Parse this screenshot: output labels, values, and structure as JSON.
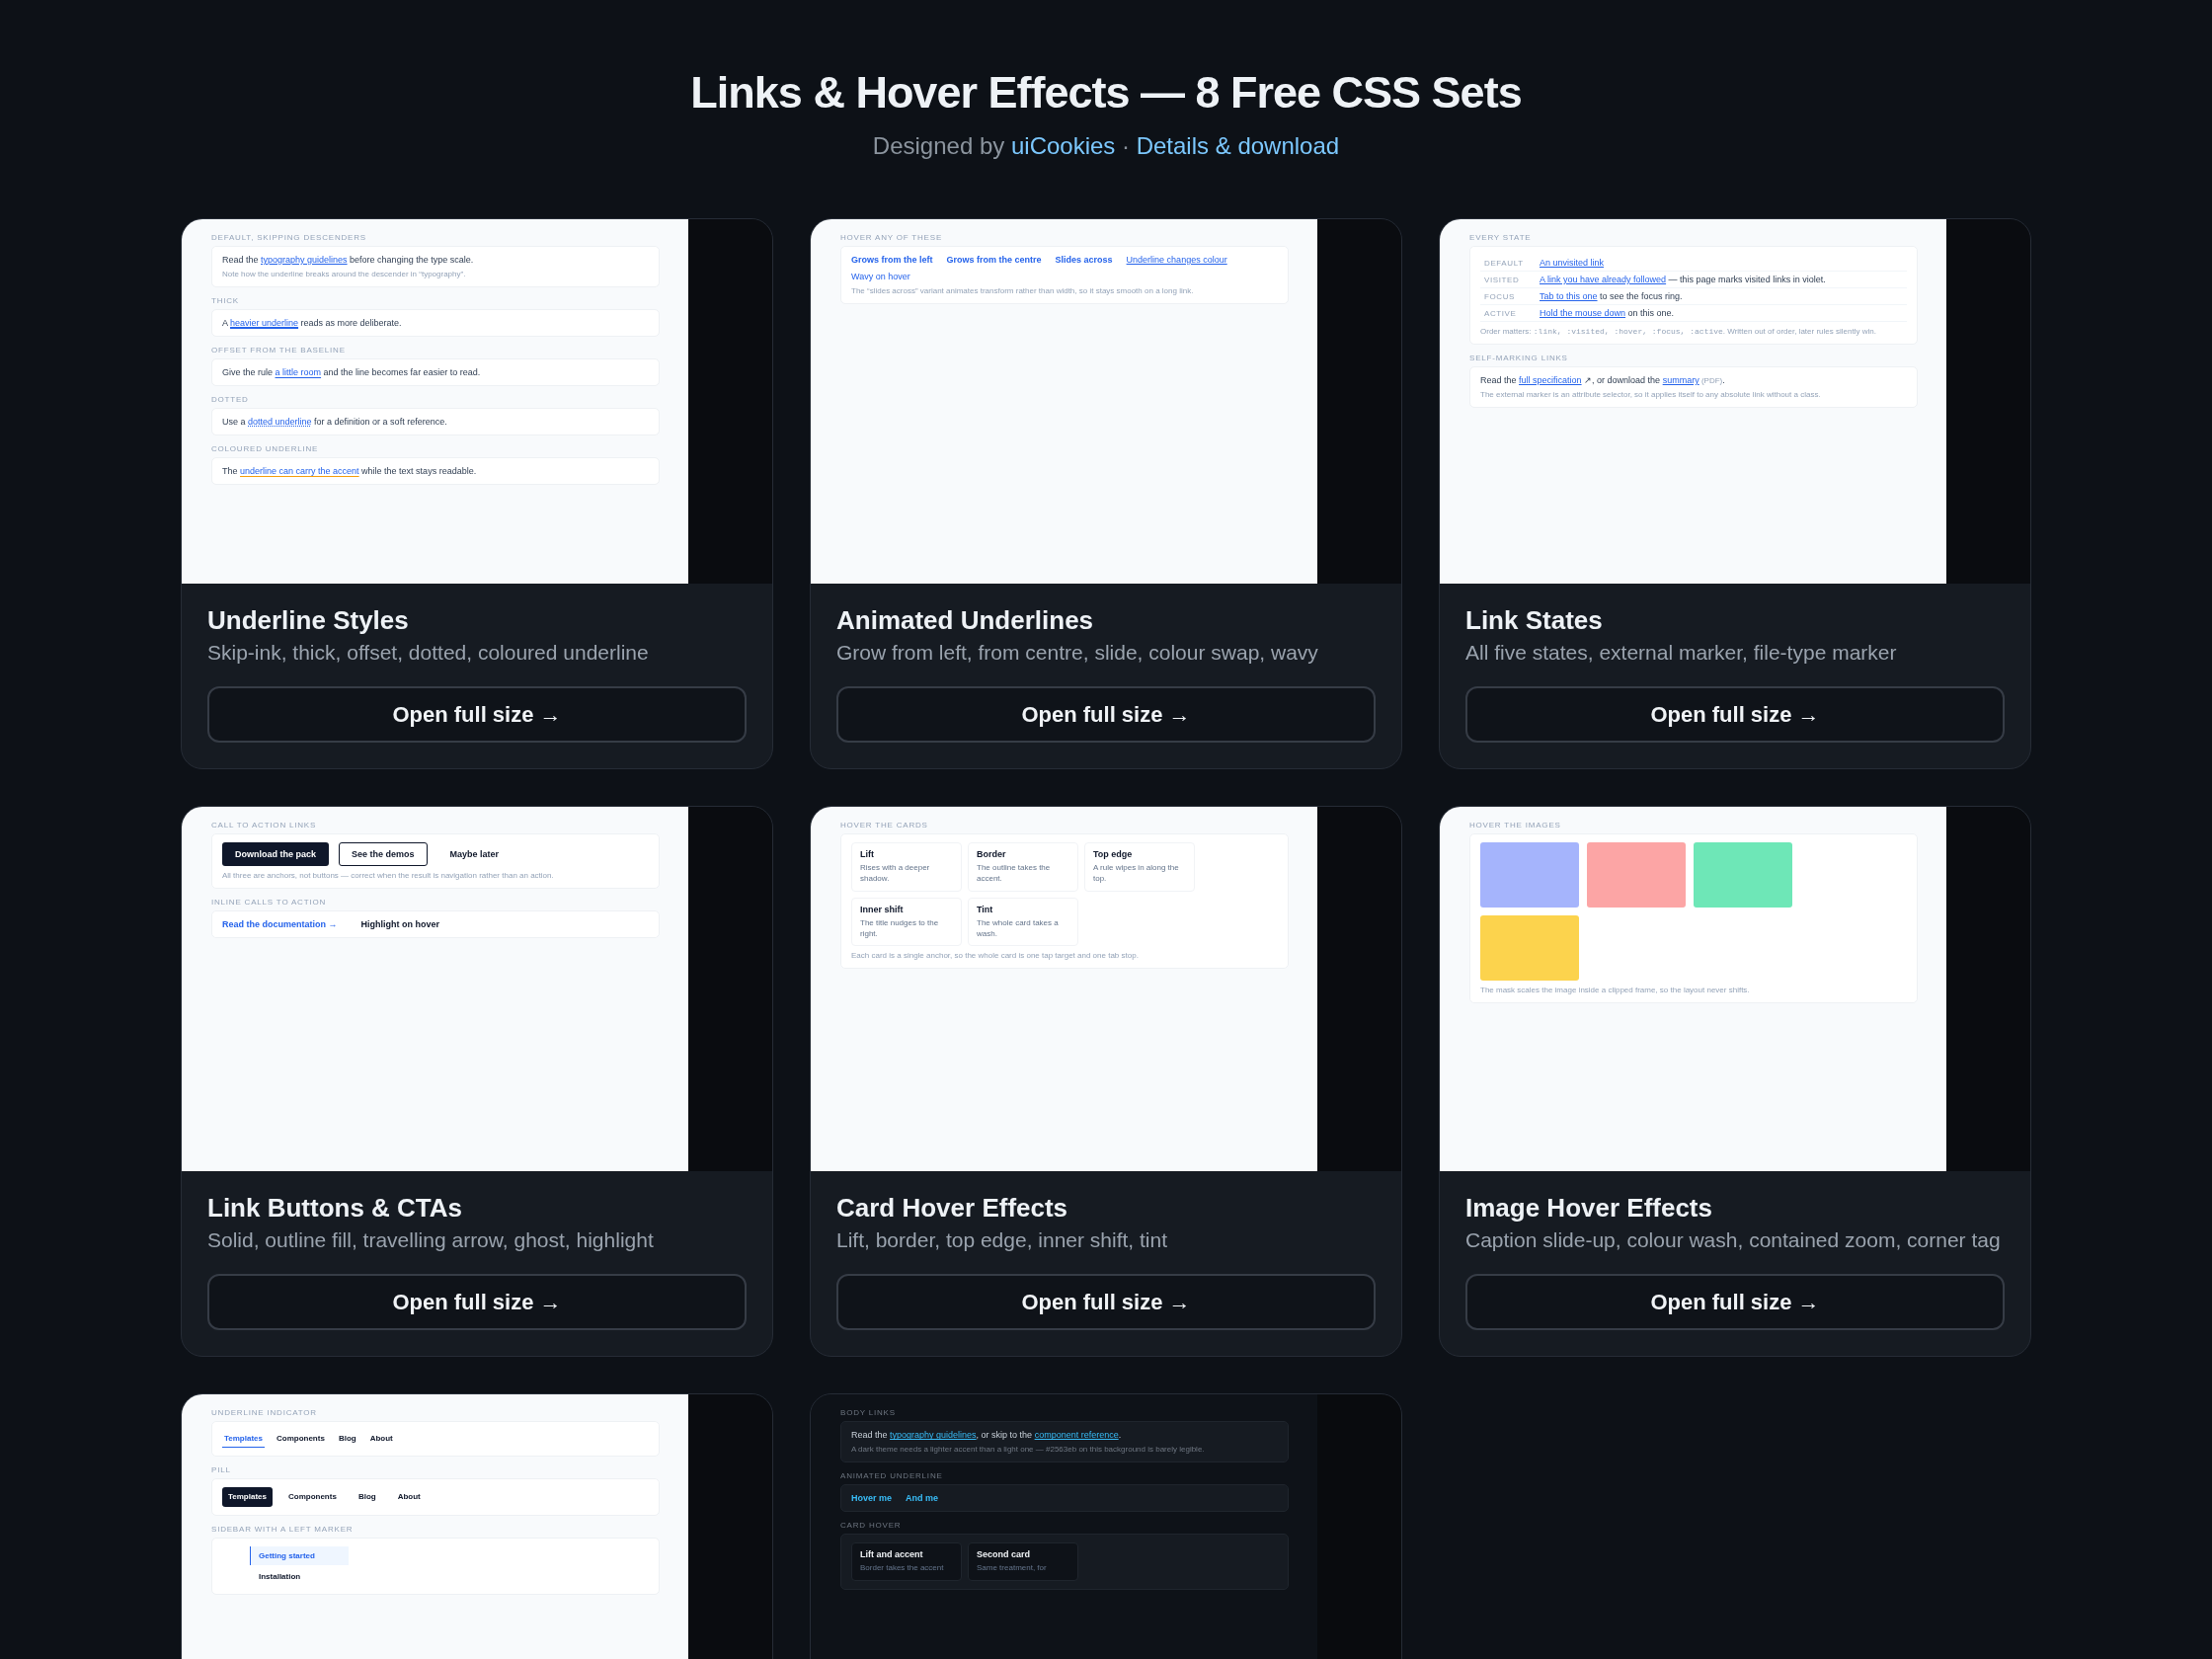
{
  "header": {
    "title": "Links & Hover Effects — 8 Free CSS Sets",
    "byline": [
      {
        "kind": "text",
        "text": "Designed by "
      },
      {
        "kind": "link",
        "text": "uiCookies"
      },
      {
        "kind": "text",
        "text": " · "
      },
      {
        "kind": "link",
        "text": "Details & download"
      }
    ]
  },
  "cards": [
    {
      "title": "Underline Styles",
      "subtitle": "Skip-ink, thick, offset, dotted, coloured underline",
      "button": "Open full size →",
      "preview": {
        "kind": "light",
        "sections": [
          {
            "label": "DEFAULT, SKIPPING DESCENDERS",
            "blocks": [
              {
                "kind": "para",
                "parts": [
                  {
                    "kind": "text",
                    "text": "Read the "
                  },
                  {
                    "kind": "link",
                    "text": "typography guidelines"
                  },
                  {
                    "kind": "text",
                    "text": " before changing the type scale."
                  }
                ]
              },
              {
                "kind": "note",
                "parts": [
                  {
                    "kind": "text",
                    "text": "Note how the underline breaks around the descender in “typography”."
                  }
                ]
              }
            ]
          },
          {
            "label": "THICK",
            "blocks": [
              {
                "kind": "para",
                "parts": [
                  {
                    "kind": "text",
                    "text": "A "
                  },
                  {
                    "kind": "link-thick",
                    "text": "heavier underline"
                  },
                  {
                    "kind": "text",
                    "text": " reads as more deliberate."
                  }
                ]
              }
            ]
          },
          {
            "label": "OFFSET FROM THE BASELINE",
            "blocks": [
              {
                "kind": "para",
                "parts": [
                  {
                    "kind": "text",
                    "text": "Give the rule "
                  },
                  {
                    "kind": "link-offset",
                    "text": "a little room"
                  },
                  {
                    "kind": "text",
                    "text": " and the line becomes far easier to read."
                  }
                ]
              }
            ]
          },
          {
            "label": "DOTTED",
            "blocks": [
              {
                "kind": "para",
                "parts": [
                  {
                    "kind": "text",
                    "text": "Use a "
                  },
                  {
                    "kind": "link-dotted",
                    "text": "dotted underline"
                  },
                  {
                    "kind": "text",
                    "text": " for a definition or a soft reference."
                  }
                ]
              }
            ]
          },
          {
            "label": "COLOURED UNDERLINE",
            "blocks": [
              {
                "kind": "para",
                "parts": [
                  {
                    "kind": "text",
                    "text": "The "
                  },
                  {
                    "kind": "link-accent",
                    "text": "underline can carry the accent"
                  },
                  {
                    "kind": "text",
                    "text": " while the text stays readable."
                  }
                ]
              }
            ]
          }
        ]
      }
    },
    {
      "title": "Animated Underlines",
      "subtitle": "Grow from left, from centre, slide, colour swap, wavy",
      "button": "Open full size →",
      "preview": {
        "kind": "light",
        "sections": [
          {
            "label": "HOVER ANY OF THESE",
            "blocks": [
              {
                "kind": "links",
                "items": [
                  {
                    "kind": "bold",
                    "text": "Grows from the left"
                  },
                  {
                    "kind": "bold",
                    "text": "Grows from the centre"
                  },
                  {
                    "kind": "bold",
                    "text": "Slides across"
                  },
                  {
                    "kind": "underlined",
                    "text": "Underline changes colour"
                  },
                  {
                    "kind": "regular",
                    "text": "Wavy on hover"
                  }
                ]
              },
              {
                "kind": "note",
                "parts": [
                  {
                    "kind": "text",
                    "text": "The “slides across” variant animates transform rather than width, so it stays smooth on a long link."
                  }
                ]
              }
            ]
          }
        ]
      }
    },
    {
      "title": "Link States",
      "subtitle": "All five states, external marker, file-type marker",
      "button": "Open full size →",
      "preview": {
        "kind": "light",
        "sections": [
          {
            "label": "EVERY STATE",
            "blocks": [
              {
                "kind": "states",
                "rows": [
                  {
                    "state": "DEFAULT",
                    "parts": [
                      {
                        "kind": "link",
                        "text": "An unvisited link"
                      }
                    ]
                  },
                  {
                    "state": "VISITED",
                    "parts": [
                      {
                        "kind": "link",
                        "text": "A link you have already followed"
                      },
                      {
                        "kind": "text",
                        "text": " — this page marks visited links in violet."
                      }
                    ]
                  },
                  {
                    "state": "FOCUS",
                    "parts": [
                      {
                        "kind": "link",
                        "text": "Tab to this one"
                      },
                      {
                        "kind": "text",
                        "text": " to see the focus ring."
                      }
                    ]
                  },
                  {
                    "state": "ACTIVE",
                    "parts": [
                      {
                        "kind": "link",
                        "text": "Hold the mouse down"
                      },
                      {
                        "kind": "text",
                        "text": " on this one."
                      }
                    ]
                  }
                ]
              },
              {
                "kind": "note",
                "parts": [
                  {
                    "kind": "text",
                    "text": "Order matters: "
                  },
                  {
                    "kind": "code",
                    "text": ":link, :visited, :hover, :focus, :active"
                  },
                  {
                    "kind": "text",
                    "text": ". Written out of order, later rules silently win."
                  }
                ]
              }
            ]
          },
          {
            "label": "SELF-MARKING LINKS",
            "blocks": [
              {
                "kind": "para",
                "parts": [
                  {
                    "kind": "text",
                    "text": "Read the "
                  },
                  {
                    "kind": "link",
                    "text": "full specification"
                  },
                  {
                    "kind": "text",
                    "text": " ↗, or download the "
                  },
                  {
                    "kind": "link",
                    "text": "summary"
                  },
                  {
                    "kind": "small",
                    "text": " (PDF)"
                  },
                  {
                    "kind": "text",
                    "text": "."
                  }
                ]
              },
              {
                "kind": "note",
                "parts": [
                  {
                    "kind": "text",
                    "text": "The external marker is an attribute selector, so it applies itself to any absolute link without a class."
                  }
                ]
              }
            ]
          }
        ]
      }
    },
    {
      "title": "Link Buttons & CTAs",
      "subtitle": "Solid, outline fill, travelling arrow, ghost, highlight",
      "button": "Open full size →",
      "preview": {
        "kind": "light",
        "sections": [
          {
            "label": "CALL TO ACTION LINKS",
            "blocks": [
              {
                "kind": "buttons",
                "items": [
                  {
                    "kind": "solid",
                    "text": "Download the pack"
                  },
                  {
                    "kind": "outline",
                    "text": "See the demos"
                  },
                  {
                    "kind": "ghost",
                    "text": "Maybe later"
                  }
                ]
              },
              {
                "kind": "note",
                "parts": [
                  {
                    "kind": "text",
                    "text": "All three are anchors, not buttons — correct when the result is navigation rather than an action."
                  }
                ]
              }
            ]
          },
          {
            "label": "INLINE CALLS TO ACTION",
            "blocks": [
              {
                "kind": "links",
                "items": [
                  {
                    "kind": "arrow",
                    "text": "Read the documentation →"
                  },
                  {
                    "kind": "highlight",
                    "text": "Highlight on hover"
                  }
                ]
              }
            ]
          }
        ]
      }
    },
    {
      "title": "Card Hover Effects",
      "subtitle": "Lift, border, top edge, inner shift, tint",
      "button": "Open full size →",
      "preview": {
        "kind": "light",
        "sections": [
          {
            "label": "HOVER THE CARDS",
            "blocks": [
              {
                "kind": "cards",
                "items": [
                  {
                    "title": "Lift",
                    "text": "Rises with a deeper shadow."
                  },
                  {
                    "title": "Border",
                    "text": "The outline takes the accent."
                  },
                  {
                    "title": "Top edge",
                    "text": "A rule wipes in along the top."
                  },
                  {
                    "title": "Inner shift",
                    "text": "The title nudges to the right."
                  },
                  {
                    "title": "Tint",
                    "text": "The whole card takes a wash."
                  }
                ]
              },
              {
                "kind": "note",
                "parts": [
                  {
                    "kind": "text",
                    "text": "Each card is a single anchor, so the whole card is one tap target and one tab stop."
                  }
                ]
              }
            ]
          }
        ]
      }
    },
    {
      "title": "Image Hover Effects",
      "subtitle": "Caption slide-up, colour wash, contained zoom, corner tag",
      "button": "Open full size →",
      "preview": {
        "kind": "light",
        "sections": [
          {
            "label": "HOVER THE IMAGES",
            "blocks": [
              {
                "kind": "tiles",
                "items": [
                  {
                    "color": "#a5b4fc"
                  },
                  {
                    "color": "#fca5a5"
                  },
                  {
                    "color": "#6ee7b7"
                  },
                  {
                    "color": "#fcd34d"
                  }
                ]
              },
              {
                "kind": "note",
                "parts": [
                  {
                    "kind": "text",
                    "text": "The mask scales the image inside a clipped frame, so the layout never shifts."
                  }
                ]
              }
            ]
          }
        ]
      }
    },
    {
      "preview": {
        "kind": "light",
        "sections": [
          {
            "label": "UNDERLINE INDICATOR",
            "blocks": [
              {
                "kind": "tabs-underline",
                "items": [
                  {
                    "text": "Templates",
                    "selected": true
                  },
                  {
                    "text": "Components",
                    "selected": false
                  },
                  {
                    "text": "Blog",
                    "selected": false
                  },
                  {
                    "text": "About",
                    "selected": false
                  }
                ]
              }
            ]
          },
          {
            "label": "PILL",
            "blocks": [
              {
                "kind": "tabs-pill",
                "items": [
                  {
                    "text": "Templates",
                    "selected": true
                  },
                  {
                    "text": "Components",
                    "selected": false
                  },
                  {
                    "text": "Blog",
                    "selected": false
                  },
                  {
                    "text": "About",
                    "selected": false
                  }
                ]
              }
            ]
          },
          {
            "label": "SIDEBAR WITH A LEFT MARKER",
            "blocks": [
              {
                "kind": "sidebar",
                "items": [
                  {
                    "text": "Getting started",
                    "selected": true
                  },
                  {
                    "text": "Installation",
                    "selected": false
                  }
                ]
              }
            ]
          }
        ]
      }
    },
    {
      "preview": {
        "kind": "dark",
        "sections": [
          {
            "label": "BODY LINKS",
            "blocks": [
              {
                "kind": "para",
                "parts": [
                  {
                    "kind": "text",
                    "text": "Read the "
                  },
                  {
                    "kind": "link",
                    "text": "typography guidelines"
                  },
                  {
                    "kind": "text",
                    "text": ", or skip to the "
                  },
                  {
                    "kind": "link",
                    "text": "component reference"
                  },
                  {
                    "kind": "text",
                    "text": "."
                  }
                ]
              },
              {
                "kind": "note",
                "parts": [
                  {
                    "kind": "text",
                    "text": "A dark theme needs a lighter accent than a light one — #2563eb on this background is barely legible."
                  }
                ]
              }
            ]
          },
          {
            "label": "ANIMATED UNDERLINE",
            "blocks": [
              {
                "kind": "links",
                "items": [
                  {
                    "kind": "bold",
                    "text": "Hover me"
                  },
                  {
                    "kind": "bold",
                    "text": "And me"
                  }
                ]
              }
            ]
          },
          {
            "label": "CARD HOVER",
            "blocks": [
              {
                "kind": "cards",
                "items": [
                  {
                    "title": "Lift and accent",
                    "text": "Border takes the accent"
                  },
                  {
                    "title": "Second card",
                    "text": "Same treatment, for"
                  }
                ]
              }
            ]
          }
        ]
      }
    }
  ]
}
